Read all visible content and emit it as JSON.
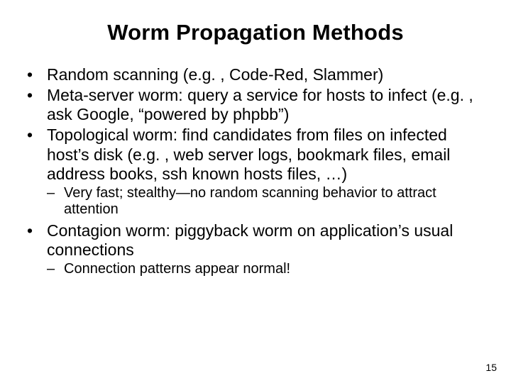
{
  "title": "Worm Propagation Methods",
  "bullets": {
    "b0": "Random scanning (e.g. , Code-Red, Slammer)",
    "b1": "Meta-server worm: query a service for hosts to infect (e.g. , ask Google, “powered by phpbb”)",
    "b2": "Topological worm: find candidates from files on infected host’s disk (e.g. , web server logs, bookmark files, email address books, ssh known hosts files, …)",
    "b2_sub0": "Very fast; stealthy—no random scanning behavior to attract attention",
    "b3": "Contagion worm: piggyback worm on application’s usual connections",
    "b3_sub0": "Connection patterns appear normal!"
  },
  "page_number": "15"
}
